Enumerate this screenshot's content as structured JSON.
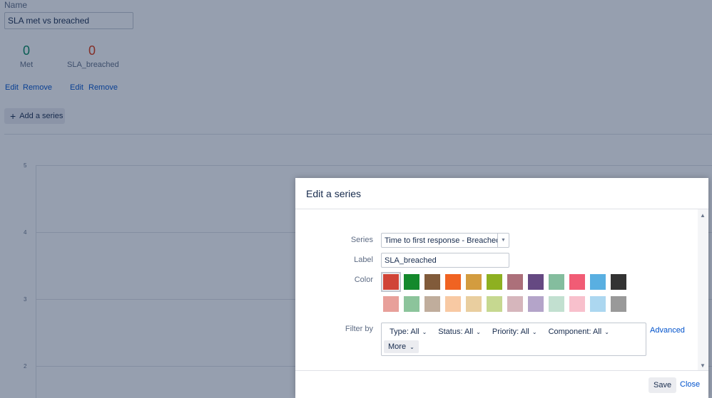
{
  "form": {
    "name_label": "Name",
    "name_value": "SLA met vs breached"
  },
  "series_stats": [
    {
      "value": "0",
      "label": "Met",
      "color": "#00875a",
      "edit": "Edit",
      "remove": "Remove"
    },
    {
      "value": "0",
      "label": "SLA_breached",
      "color": "#de350b",
      "edit": "Edit",
      "remove": "Remove"
    }
  ],
  "add_series_label": "Add a series",
  "chart": {
    "y_ticks": [
      "5",
      "4",
      "3",
      "2"
    ]
  },
  "dialog": {
    "title": "Edit a series",
    "series_label": "Series",
    "series_value": "Time to first response - Breached",
    "label_label": "Label",
    "label_value": "SLA_breached",
    "color_label": "Color",
    "colors_row1": [
      "#d04437",
      "#14892c",
      "#815b3a",
      "#f06322",
      "#d39c3f",
      "#8eb021",
      "#ac707a",
      "#654982",
      "#84bd9e",
      "#f15c75",
      "#59afe1",
      "#333333"
    ],
    "colors_row2": [
      "#e8a09a",
      "#8cc49b",
      "#c0ad9c",
      "#f8c9a3",
      "#e9ce9f",
      "#c6d890",
      "#d6b6bc",
      "#b4a4c9",
      "#c2e0d0",
      "#f8c0cc",
      "#acd7f0",
      "#999999"
    ],
    "filter_label": "Filter by",
    "filters": [
      {
        "label": "Type: All"
      },
      {
        "label": "Status: All"
      },
      {
        "label": "Priority: All"
      },
      {
        "label": "Component: All"
      }
    ],
    "more_label": "More",
    "advanced_label": "Advanced",
    "save_label": "Save",
    "close_label": "Close"
  }
}
